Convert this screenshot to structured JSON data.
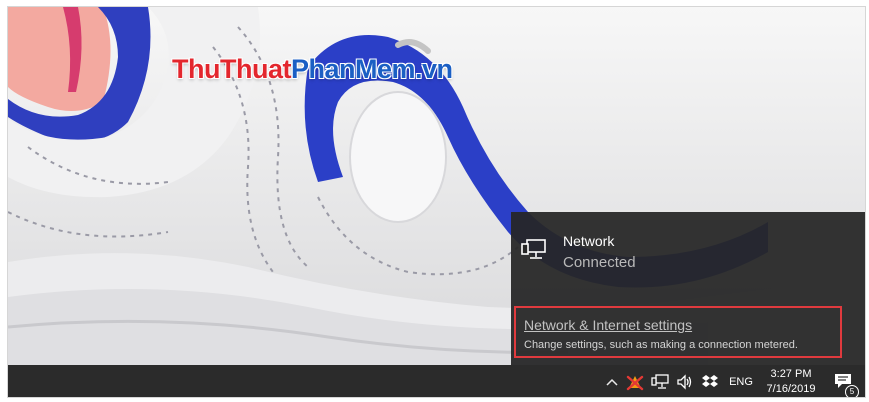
{
  "watermark": {
    "part_red": "ThuThuat",
    "part_blue": "PhanMem",
    "part_red2": ".vn"
  },
  "flyout": {
    "network_icon": "wired-network-icon",
    "network_name": "Network",
    "network_status": "Connected",
    "settings_link": "Network & Internet settings",
    "settings_desc": "Change settings, such as making a connection metered.",
    "highlight_color": "#e03a3e"
  },
  "taskbar": {
    "chevron_glyph": "^",
    "language": "ENG",
    "time": "3:27 PM",
    "date": "7/16/2019",
    "notification_count": "5",
    "icons": [
      "chevron-up-icon",
      "app-tray-icon",
      "network-icon",
      "volume-icon",
      "dropbox-icon",
      "action-center-icon"
    ]
  }
}
